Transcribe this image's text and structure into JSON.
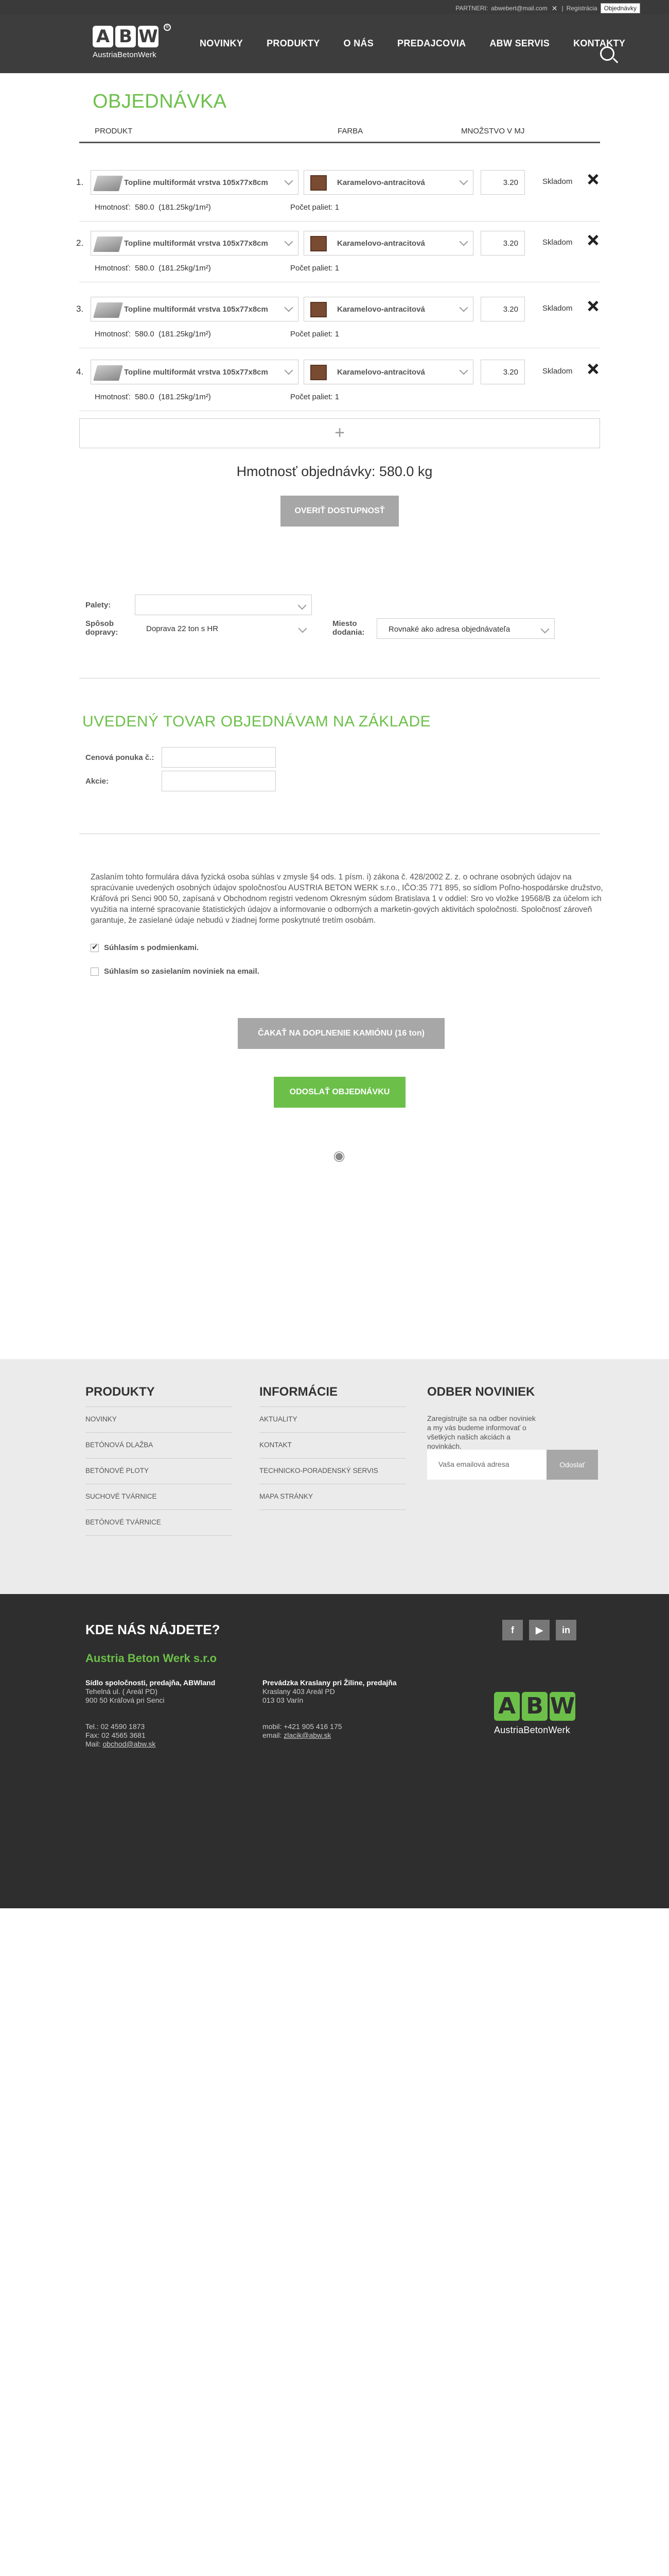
{
  "topbar": {
    "partner_label": "PARTNERI:",
    "user_email": "abwebert@mail.com",
    "registration_link": "Registrácia",
    "orders_button": "Objednávky"
  },
  "header": {
    "logo_text": "ABW",
    "logo_letters": [
      "A",
      "B",
      "W"
    ],
    "logo_subtitle": "AustriaBetonWerk",
    "nav": [
      "NOVINKY",
      "PRODUKTY",
      "O NÁS",
      "PREDAJCOVIA",
      "ABW SERVIS",
      "KONTAKTY"
    ],
    "search_icon": "search-icon"
  },
  "order": {
    "title": "OBJEDNÁVKA",
    "columns": [
      "PRODUKT",
      "FARBA",
      "MNOŽSTVO V MJ"
    ],
    "rows": [
      {
        "num": "1.",
        "product": "Topline multiformát vrstva 105x77x8cm",
        "color": "Karamelovo-antracitová",
        "qty": "3.20",
        "stock": "Skladom",
        "weight_label": "Hmotnosť:",
        "weight": "580.0",
        "density": "(181.25kg/1m²)",
        "pallets_label": "Počet paliet:",
        "pallets": "1"
      },
      {
        "num": "2.",
        "product": "Topline multiformát vrstva 105x77x8cm",
        "color": "Karamelovo-antracitová",
        "qty": "3.20",
        "stock": "Skladom",
        "weight_label": "Hmotnosť:",
        "weight": "580.0",
        "density": "(181.25kg/1m²)",
        "pallets_label": "Počet paliet:",
        "pallets": "1"
      },
      {
        "num": "3.",
        "product": "Topline multiformát vrstva 105x77x8cm",
        "color": "Karamelovo-antracitová",
        "qty": "3.20",
        "stock": "Skladom",
        "weight_label": "Hmotnosť:",
        "weight": "580.0",
        "density": "(181.25kg/1m²)",
        "pallets_label": "Počet paliet:",
        "pallets": "1"
      },
      {
        "num": "4.",
        "product": "Topline multiformát vrstva 105x77x8cm",
        "color": "Karamelovo-antracitová",
        "qty": "3.20",
        "stock": "Skladom",
        "weight_label": "Hmotnosť:",
        "weight": "580.0",
        "density": "(181.25kg/1m²)",
        "pallets_label": "Počet paliet:",
        "pallets": "1"
      }
    ],
    "add_row_symbol": "+",
    "total_weight": "Hmotnosť objednávky: 580.0 kg",
    "verify_button": "OVERIŤ DOSTUPNOSŤ",
    "swatch_color": "#7a4b33"
  },
  "shipping": {
    "pallets_label": "Palety:",
    "pallets_value": "",
    "transport_label": "Spôsob dopravy:",
    "transport_value": "Doprava 22 ton s HR",
    "delivery_label": "Miesto dodania:",
    "delivery_value": "Rovnaké ako adresa objednávateľa"
  },
  "basis": {
    "title": "UVEDENÝ TOVAR OBJEDNÁVAM NA ZÁKLADE",
    "price_offer_label": "Cenová ponuka č.:",
    "price_offer_value": "",
    "promo_label": "Akcie:",
    "promo_value": ""
  },
  "consent": {
    "text": "Zaslaním tohto formulára dáva fyzická osoba súhlas v zmysle §4 ods. 1 písm. i) zákona č. 428/2002 Z. z. o ochrane osobných údajov na spracúvanie uvedených osobných údajov spoločnosťou AUSTRIA BETON WERK s.r.o., IČO:35 771 895, so sídlom Poľno-hospodárske družstvo, Kráľová pri Senci 900 50, zapísaná v Obchodnom registri vedenom Okresným súdom Bratislava 1 v oddiel: Sro vo vložke 19568/B za účelom ich využitia na interné spracovanie štatistických údajov a informovanie o odborných a marketin-gových aktivitách spoločnosti. Spoločnosť zároveň garantuje, že zasielané údaje nebudú v žiadnej forme poskytnuté tretím osobám.",
    "terms_label": "Súhlasím s podmienkami.",
    "terms_checked": true,
    "newsletter_label": "Súhlasím so zasielaním noviniek na email.",
    "newsletter_checked": false
  },
  "actions": {
    "wait_button": "ČAKAŤ NA DOPLNENIE KAMIÓNU (16 ton)",
    "send_button": "ODOSLAŤ OBJEDNÁVKU",
    "send_color": "#6cc04a"
  },
  "footer": {
    "products_title": "PRODUKTY",
    "products": [
      "NOVINKY",
      "BETÓNOVÁ DLAŽBA",
      "BETÓNOVÉ PLOTY",
      "SUCHOVÉ TVÁRNICE",
      "BETÓNOVÉ TVÁRNICE"
    ],
    "info_title": "INFORMÁCIE",
    "info": [
      "AKTUALITY",
      "KONTAKT",
      "TECHNICKO-PORADENSKÝ SERVIS",
      "MAPA STRÁNKY"
    ],
    "newsletter_title": "ODBER NOVINIEK",
    "newsletter_desc": "Zaregistrujte sa na odber noviniek a my vás budeme informovať o všetkých našich akciách a novinkách.",
    "newsletter_placeholder": "Vaša emailová adresa",
    "newsletter_button": "Odoslať"
  },
  "contact": {
    "title": "KDE NÁS NÁJDETE?",
    "company": "Austria Beton Werk s.r.o",
    "hq_title": "Sídlo spoločnosti, predajňa, ABWland",
    "hq_line1": "Tehelná ul. ( Areál PD)",
    "hq_line2": "900 50 Kráľová pri Senci",
    "hq_tel": "Tel.: 02 4590 1873",
    "hq_fax": "Fax: 02 4565 3681",
    "hq_mail_label": "Mail:",
    "hq_mail": "obchod@abw.sk",
    "branch_title": "Prevádzka Kraslany pri Žiline, predajňa",
    "branch_line1": "Kraslany 403 Areál PD",
    "branch_line2": "013 03 Varín",
    "branch_mobile": "mobil: +421 905 416 175",
    "branch_email_label": "email:",
    "branch_email": "zlacik@abw.sk",
    "social": [
      "f",
      "▶",
      "in"
    ],
    "brand_color": "#6cc04a"
  }
}
